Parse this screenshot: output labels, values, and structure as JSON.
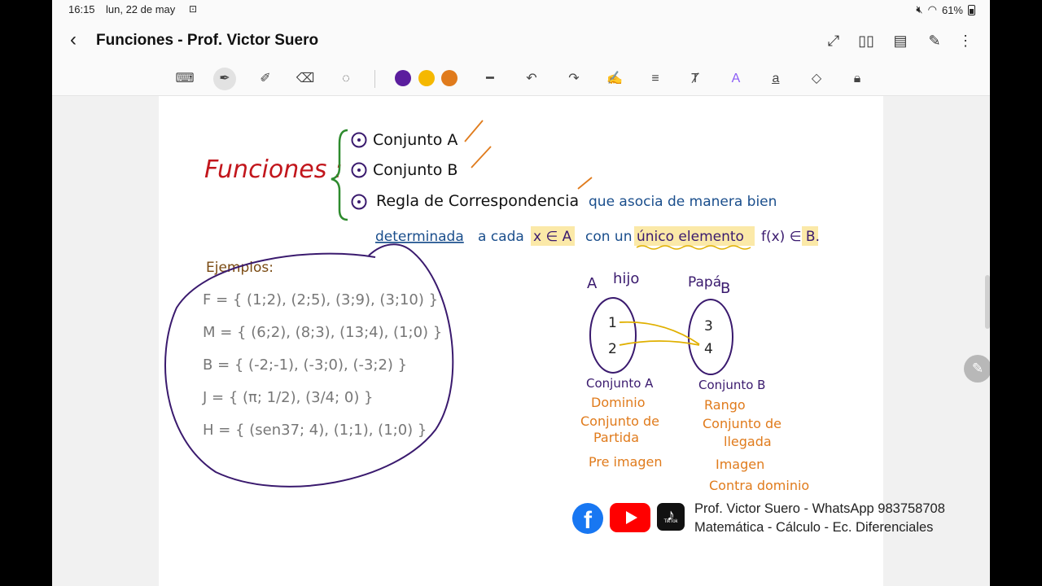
{
  "status_bar": {
    "time": "16:15",
    "date": "lun, 22 de may",
    "battery": "61%"
  },
  "app": {
    "title": "Funciones - Prof. Victor Suero"
  },
  "toolbar": {
    "pen_colors": [
      "#5b1e9e",
      "#f5b800",
      "#e07b1c"
    ]
  },
  "note": {
    "heading": "Funciones :",
    "components": [
      "Conjunto A",
      "Conjunto B",
      "Regla de Correspondencia"
    ],
    "definition_part1": "que asocia de manera bien",
    "definition_part2_a": "determinada",
    "definition_part2_b": "a cada",
    "definition_x": "x ∈ A",
    "definition_part2_c": "con un",
    "definition_unique": "único elemento",
    "definition_fx": "f(x) ∈ B.",
    "examples_title": "Ejemplos:",
    "examples": [
      "F = { (1;2), (2;5), (3;9), (3;10) }",
      "M = { (6;2), (8;3), (13;4), (1;0) }",
      "B = { (-2;-1), (-3;0), (-3;2) }",
      "J = { (π; 1/2), (3/4; 0) }",
      "H = { (sen37; 4), (1;1), (1;0) }"
    ],
    "diagram": {
      "set_a_letter": "A",
      "set_a_tag": "hijo",
      "set_a_elements": [
        "1",
        "2"
      ],
      "set_b_letter": "B",
      "set_b_tag": "Papá",
      "set_b_elements": [
        "3",
        "4"
      ],
      "set_a_name": "Conjunto A",
      "set_a_terms": [
        "Dominio",
        "Conjunto de",
        "Partida",
        "Pre imagen"
      ],
      "set_b_name": "Conjunto B",
      "set_b_terms": [
        "Rango",
        "Conjunto de",
        "llegada",
        "Imagen",
        "Contra dominio"
      ]
    }
  },
  "footer": {
    "line1": "Prof. Victor Suero - WhatsApp 983758708",
    "line2": "Matemática - Cálculo - Ec. Diferenciales",
    "tiktok_label": "TikTok"
  }
}
